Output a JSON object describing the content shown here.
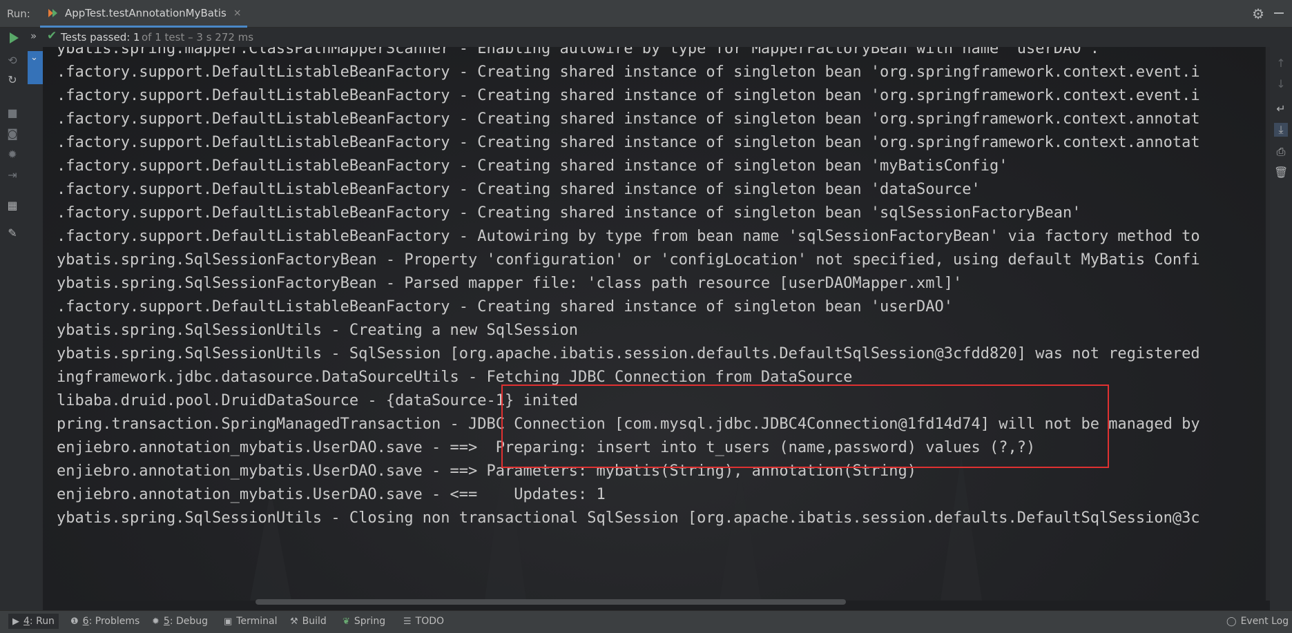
{
  "header": {
    "run_label": "Run:",
    "tab_title": "AppTest.testAnnotationMyBatis",
    "tab_close": "×"
  },
  "status": {
    "passed": "Tests passed: 1",
    "detail": "of 1 test – 3 s 272 ms"
  },
  "console": {
    "lines": [
      "ybatis.spring.mapper.ClassPathMapperScanner - Enabling autowire by type for MapperFactoryBean with name 'userDAO'.",
      ".factory.support.DefaultListableBeanFactory - Creating shared instance of singleton bean 'org.springframework.context.event.i",
      ".factory.support.DefaultListableBeanFactory - Creating shared instance of singleton bean 'org.springframework.context.event.i",
      ".factory.support.DefaultListableBeanFactory - Creating shared instance of singleton bean 'org.springframework.context.annotat",
      ".factory.support.DefaultListableBeanFactory - Creating shared instance of singleton bean 'org.springframework.context.annotat",
      ".factory.support.DefaultListableBeanFactory - Creating shared instance of singleton bean 'myBatisConfig'",
      ".factory.support.DefaultListableBeanFactory - Creating shared instance of singleton bean 'dataSource'",
      ".factory.support.DefaultListableBeanFactory - Creating shared instance of singleton bean 'sqlSessionFactoryBean'",
      ".factory.support.DefaultListableBeanFactory - Autowiring by type from bean name 'sqlSessionFactoryBean' via factory method to",
      "ybatis.spring.SqlSessionFactoryBean - Property 'configuration' or 'configLocation' not specified, using default MyBatis Confi",
      "ybatis.spring.SqlSessionFactoryBean - Parsed mapper file: 'class path resource [userDAOMapper.xml]'",
      ".factory.support.DefaultListableBeanFactory - Creating shared instance of singleton bean 'userDAO'",
      "ybatis.spring.SqlSessionUtils - Creating a new SqlSession",
      "ybatis.spring.SqlSessionUtils - SqlSession [org.apache.ibatis.session.defaults.DefaultSqlSession@3cfdd820] was not registered",
      "ingframework.jdbc.datasource.DataSourceUtils - Fetching JDBC Connection from DataSource",
      "libaba.druid.pool.DruidDataSource - {dataSource-1} inited",
      "pring.transaction.SpringManagedTransaction - JDBC Connection [com.mysql.jdbc.JDBC4Connection@1fd14d74] will not be managed by",
      "enjiebro.annotation_mybatis.UserDAO.save - ==>  Preparing: insert into t_users (name,password) values (?,?)",
      "enjiebro.annotation_mybatis.UserDAO.save - ==> Parameters: mybatis(String), annotation(String)",
      "enjiebro.annotation_mybatis.UserDAO.save - <==    Updates: 1",
      "ybatis.spring.SqlSessionUtils - Closing non transactional SqlSession [org.apache.ibatis.session.defaults.DefaultSqlSession@3c"
    ]
  },
  "bottom": {
    "run": {
      "key": "4",
      "label": ": Run"
    },
    "problems": {
      "key": "6",
      "label": ": Problems"
    },
    "debug": {
      "key": "5",
      "label": ": Debug"
    },
    "terminal": "Terminal",
    "build": "Build",
    "spring": "Spring",
    "todo": "TODO",
    "event_log": "Event Log"
  },
  "icons": {
    "run": "play-icon",
    "rerun": "double-chevron-icon",
    "check": "check-icon",
    "settings": "gear-icon"
  },
  "colors": {
    "accent": "#4a88c7",
    "pass": "#59a869",
    "highlight": "#e03131"
  }
}
